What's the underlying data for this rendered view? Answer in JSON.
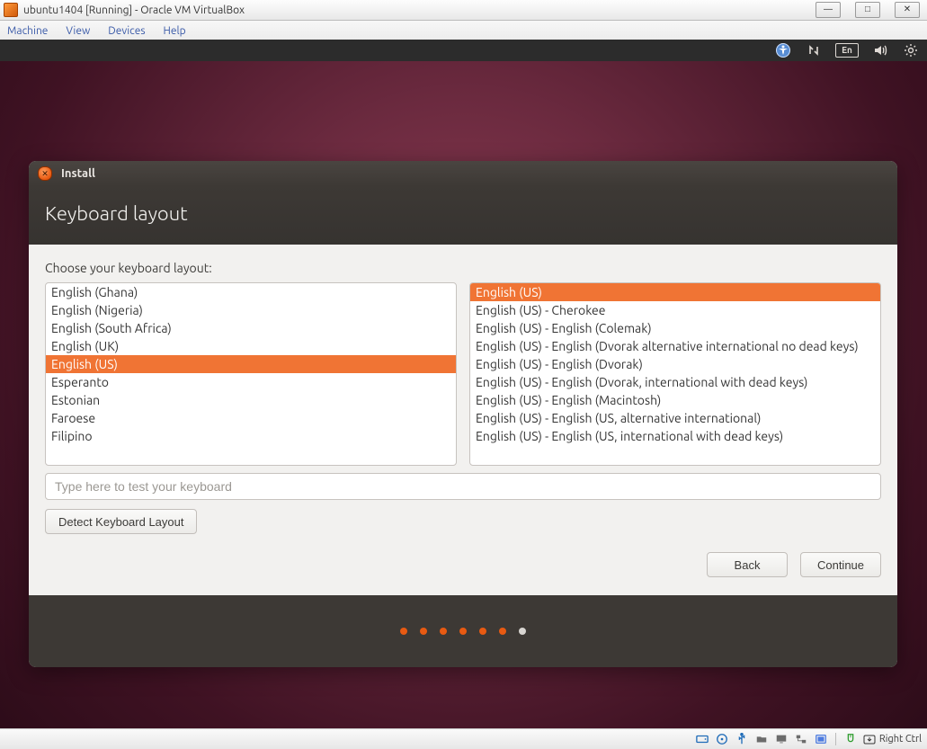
{
  "vb": {
    "title": "ubuntu1404 [Running] - Oracle VM VirtualBox",
    "menu": [
      "Machine",
      "View",
      "Devices",
      "Help"
    ],
    "status": {
      "host_key_label": "Right Ctrl"
    }
  },
  "panel": {
    "lang_indicator": "En"
  },
  "installer": {
    "window_title": "Install",
    "heading": "Keyboard layout",
    "prompt": "Choose your keyboard layout:",
    "left_list": [
      "English (Ghana)",
      "English (Nigeria)",
      "English (South Africa)",
      "English (UK)",
      "English (US)",
      "Esperanto",
      "Estonian",
      "Faroese",
      "Filipino"
    ],
    "left_selected_index": 4,
    "right_list": [
      "English (US)",
      "English (US) - Cherokee",
      "English (US) - English (Colemak)",
      "English (US) - English (Dvorak alternative international no dead keys)",
      "English (US) - English (Dvorak)",
      "English (US) - English (Dvorak, international with dead keys)",
      "English (US) - English (Macintosh)",
      "English (US) - English (US, alternative international)",
      "English (US) - English (US, international with dead keys)"
    ],
    "right_selected_index": 0,
    "test_placeholder": "Type here to test your keyboard",
    "detect_label": "Detect Keyboard Layout",
    "back_label": "Back",
    "continue_label": "Continue",
    "progress": {
      "total": 7,
      "current_index": 6
    }
  }
}
